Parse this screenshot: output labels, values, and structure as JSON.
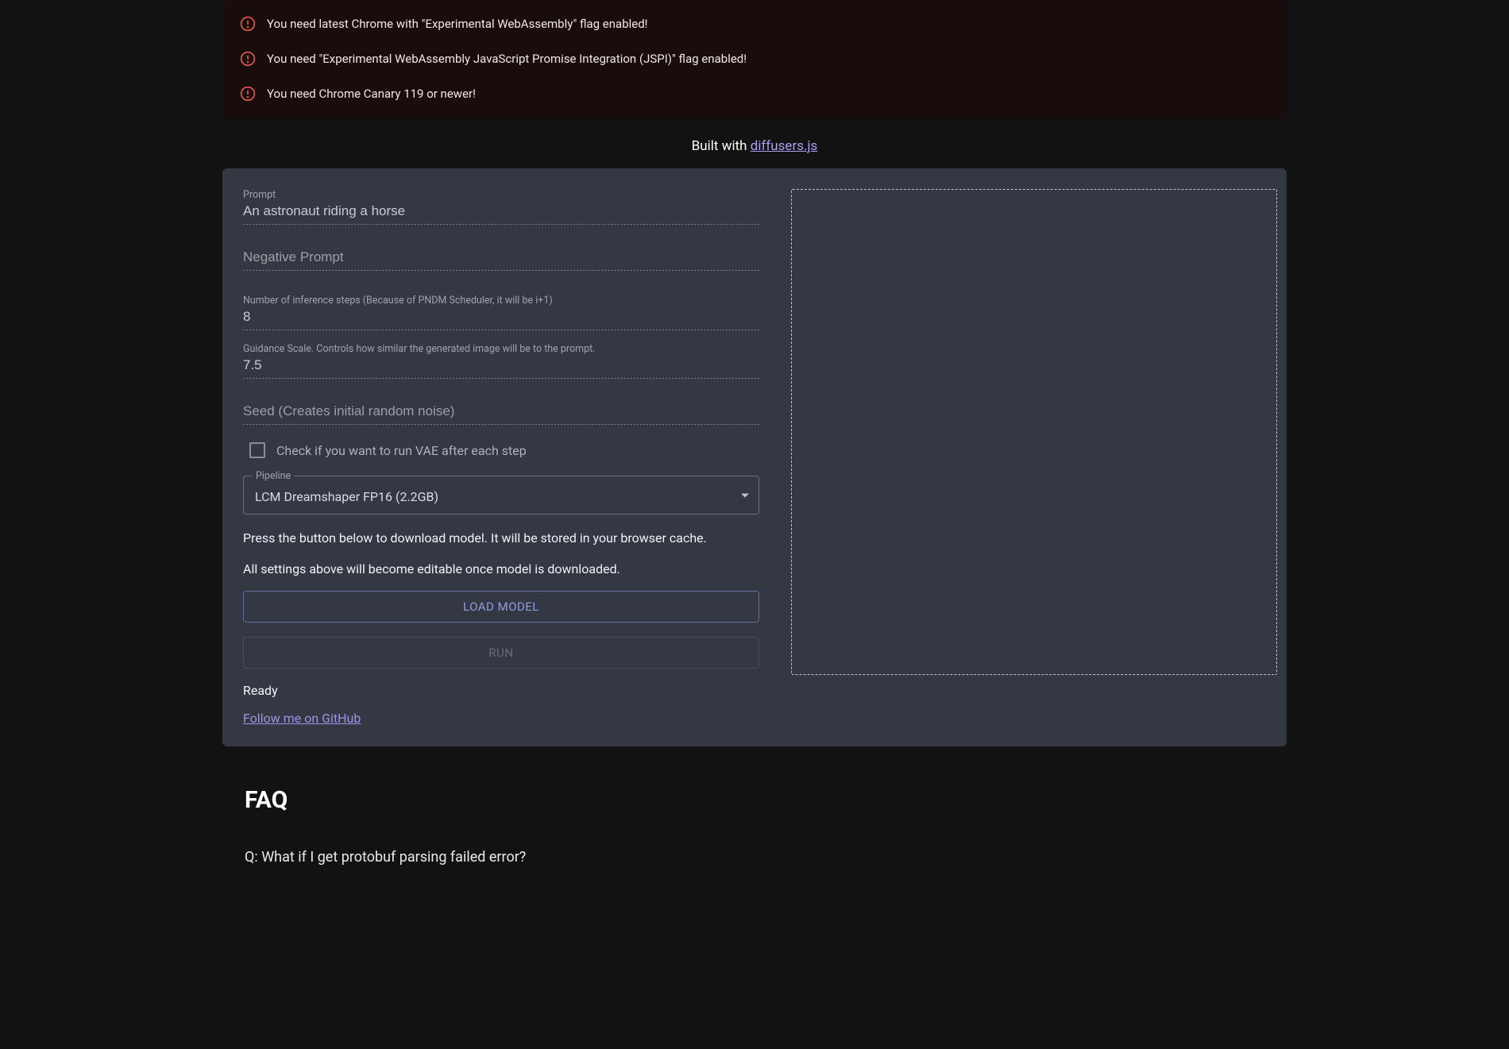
{
  "alerts": [
    "You need latest Chrome with \"Experimental WebAssembly\" flag enabled!",
    "You need \"Experimental WebAssembly JavaScript Promise Integration (JSPI)\" flag enabled!",
    "You need Chrome Canary 119 or newer!"
  ],
  "built_with": {
    "prefix": "Built with ",
    "link_text": "diffusers.js"
  },
  "form": {
    "prompt": {
      "label": "Prompt",
      "value": "An astronaut riding a horse"
    },
    "neg_prompt": {
      "placeholder": "Negative Prompt",
      "value": ""
    },
    "steps": {
      "label": "Number of inference steps (Because of PNDM Scheduler, it will be i+1)",
      "value": "8"
    },
    "guidance": {
      "label": "Guidance Scale. Controls how similar the generated image will be to the prompt.",
      "value": "7.5"
    },
    "seed": {
      "placeholder": "Seed (Creates initial random noise)",
      "value": ""
    },
    "vae_checkbox_label": "Check if you want to run VAE after each step",
    "pipeline": {
      "legend": "Pipeline",
      "value": "LCM Dreamshaper FP16 (2.2GB)"
    }
  },
  "info": {
    "p1": "Press the button below to download model. It will be stored in your browser cache.",
    "p2": "All settings above will become editable once model is downloaded."
  },
  "buttons": {
    "load": "LOAD MODEL",
    "run": "RUN"
  },
  "status": "Ready",
  "github_link": "Follow me on GitHub",
  "faq": {
    "heading": "FAQ",
    "q1": "Q: What if I get protobuf parsing failed error?"
  }
}
